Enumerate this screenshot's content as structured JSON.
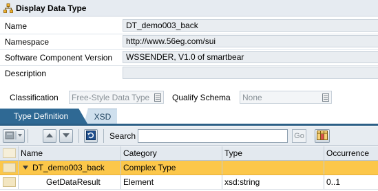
{
  "window": {
    "title": "Display Data Type",
    "title_icon": "datatype-hierarchy-icon"
  },
  "fields": [
    {
      "label": "Name",
      "value": "DT_demo003_back"
    },
    {
      "label": "Namespace",
      "value": "http://www.56eg.com/sui"
    },
    {
      "label": "Software Component Version",
      "value": "WSSENDER, V1.0 of smartbear"
    },
    {
      "label": "Description",
      "value": ""
    }
  ],
  "classification": {
    "label": "Classification",
    "value": "Free-Style Data Type",
    "qualify_label": "Qualify Schema",
    "qualify_value": "None"
  },
  "tabs": [
    {
      "label": "Type Definition",
      "active": true
    },
    {
      "label": "XSD",
      "active": false
    }
  ],
  "toolbar": {
    "search_label": "Search",
    "search_value": "",
    "go_label": "Go",
    "icons": [
      "insert-row-icon",
      "move-up-icon",
      "move-down-icon",
      "refresh-icon",
      "table-settings-icon"
    ]
  },
  "table": {
    "columns": [
      "Name",
      "Category",
      "Type",
      "Occurrence"
    ],
    "rows": [
      {
        "name": "DT_demo003_back",
        "category": "Complex Type",
        "type": "",
        "occurrence": "",
        "expanded": true,
        "selected": true
      },
      {
        "name": "GetDataResult",
        "category": "Element",
        "type": "xsd:string",
        "occurrence": "0..1",
        "expanded": false,
        "selected": false
      }
    ]
  },
  "colors": {
    "tab_active": "#2f6994",
    "selected_row": "#fcc74a",
    "header_bg": "#e6ebf1"
  }
}
